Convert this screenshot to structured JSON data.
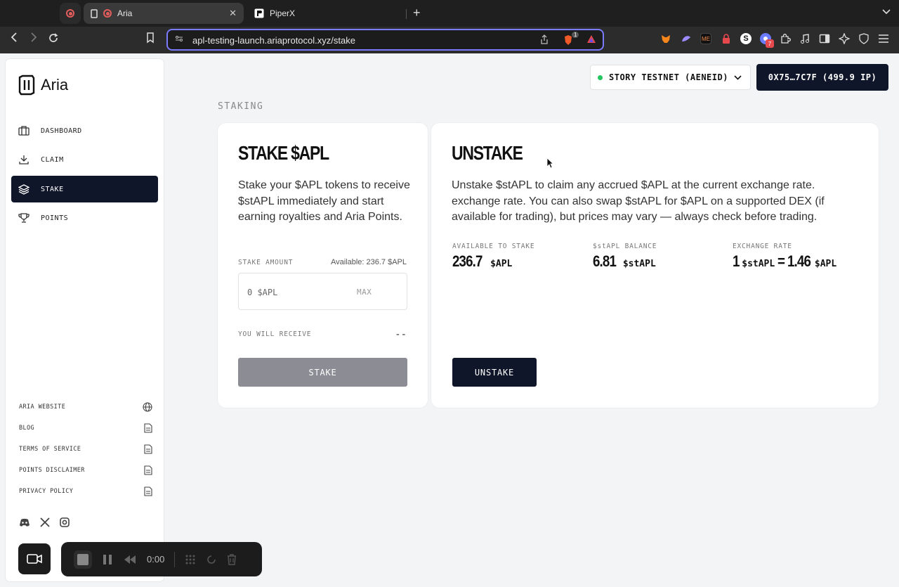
{
  "browser": {
    "tabs": [
      {
        "label": "Aria"
      },
      {
        "label": "PiperX"
      }
    ],
    "url": "apl-testing-launch.ariaprotocol.xyz/stake",
    "ext_badge_count": "7",
    "brave_badge_count": "1"
  },
  "sidebar": {
    "logo_text": "Aria",
    "items": [
      {
        "label": "DASHBOARD"
      },
      {
        "label": "CLAIM"
      },
      {
        "label": "STAKE"
      },
      {
        "label": "POINTS"
      }
    ],
    "footer_links": [
      {
        "label": "ARIA WEBSITE"
      },
      {
        "label": "BLOG"
      },
      {
        "label": "TERMS OF SERVICE"
      },
      {
        "label": "POINTS DISCLAIMER"
      },
      {
        "label": "PRIVACY POLICY"
      }
    ]
  },
  "header": {
    "network": "STORY TESTNET (AENEID)",
    "wallet": "0X75…7C7F (499.9 IP)"
  },
  "page": {
    "section_title": "STAKING"
  },
  "stake_card": {
    "title": "STAKE $APL",
    "description": "Stake your $APL tokens to receive $stAPL immediately and start earning royalties and Aria Points.",
    "amount_label": "STAKE AMOUNT",
    "available": "Available: 236.7 $APL",
    "amount_value": "0 $APL",
    "max_label": "MAX",
    "receive_label": "YOU WILL RECEIVE",
    "receive_value": "--",
    "button": "STAKE"
  },
  "unstake_card": {
    "title": "UNSTAKE",
    "description": "Unstake $stAPL to claim any accrued $APL at the current exchange rate. exchange rate. You can also swap $stAPL for $APL on a supported DEX (if available for trading), but prices may vary — always check before trading.",
    "stats": [
      {
        "label": "AVAILABLE TO STAKE",
        "value": "236.7",
        "unit": "$APL"
      },
      {
        "label": "$stAPL BALANCE",
        "value": "6.81",
        "unit": "$stAPL"
      },
      {
        "label": "EXCHANGE RATE",
        "value_a": "1",
        "unit_a": "$stAPL",
        "eq": "=",
        "value_b": "1.46",
        "unit_b": "$APL"
      }
    ],
    "button": "UNSTAKE"
  },
  "recorder": {
    "time": "0:00"
  },
  "colors": {
    "accent_dark": "#0f1629",
    "disabled_button": "#8b8c94",
    "network_dot": "#22c55e",
    "url_focus": "#7b7bff"
  }
}
